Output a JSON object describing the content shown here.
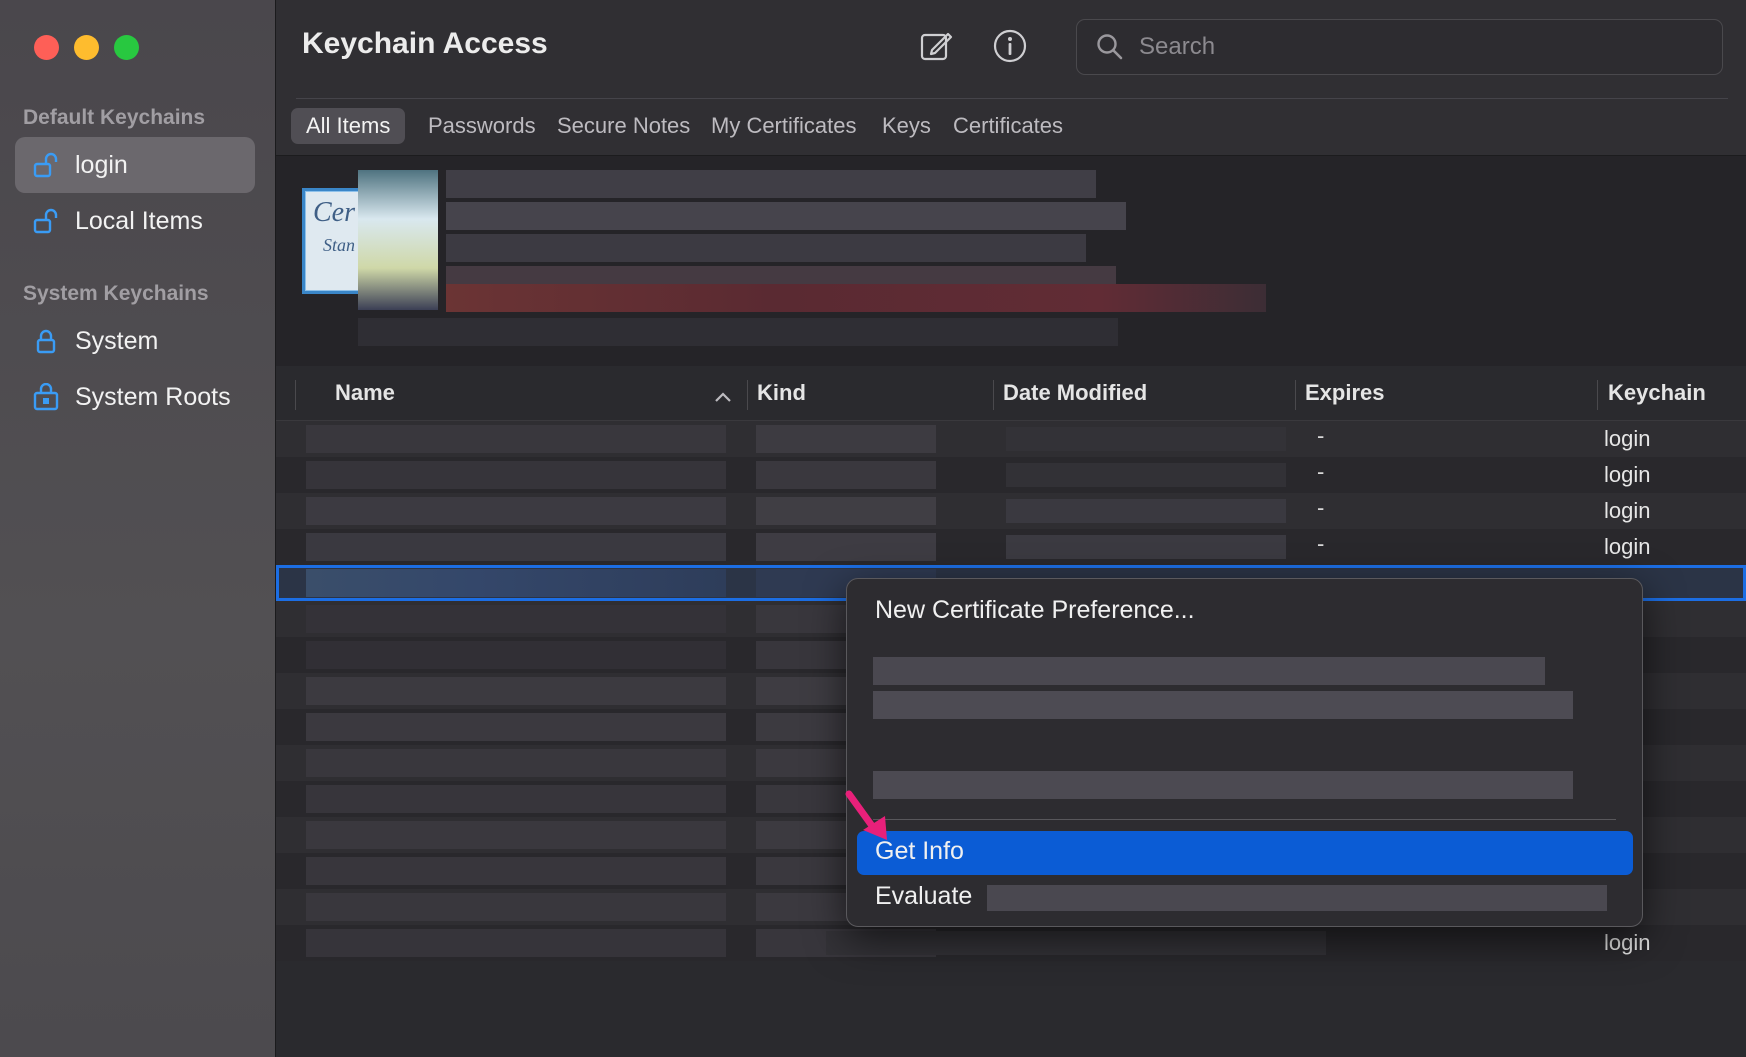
{
  "window": {
    "title": "Keychain Access",
    "controls": [
      "close",
      "minimize",
      "zoom"
    ]
  },
  "sidebar": {
    "default_heading": "Default Keychains",
    "system_heading": "System Keychains",
    "items": [
      {
        "label": "login",
        "icon": "unlocked-padlock-icon",
        "selected": true
      },
      {
        "label": "Local Items",
        "icon": "unlocked-padlock-icon",
        "selected": false
      },
      {
        "label": "System",
        "icon": "locked-padlock-icon",
        "selected": false
      },
      {
        "label": "System Roots",
        "icon": "locked-cabinet-icon",
        "selected": false
      }
    ]
  },
  "toolbar": {
    "new_item_icon": "compose-icon",
    "info_icon": "info-icon",
    "search_placeholder": "Search",
    "search_value": ""
  },
  "tabs": [
    "All Items",
    "Passwords",
    "Secure Notes",
    "My Certificates",
    "Keys",
    "Certificates"
  ],
  "active_tab": "All Items",
  "preview": {
    "icon_text_1": "Cer",
    "icon_text_2": "Stan"
  },
  "table": {
    "columns": [
      "Name",
      "Kind",
      "Date Modified",
      "Expires",
      "Keychain"
    ],
    "sort_column": "Name",
    "sort_direction": "ascending",
    "rows": [
      {
        "expires": "-",
        "keychain": "login"
      },
      {
        "expires": "-",
        "keychain": "login"
      },
      {
        "expires": "-",
        "keychain": "login"
      },
      {
        "expires": "-",
        "keychain": "login"
      },
      {
        "expires": "",
        "keychain": "n",
        "selected": true
      },
      {
        "expires": "",
        "keychain": "n"
      },
      {
        "expires": "",
        "keychain": "n"
      },
      {
        "expires": "",
        "keychain": "n"
      },
      {
        "expires": "",
        "keychain": "n"
      },
      {
        "expires": "",
        "keychain": "n"
      },
      {
        "expires": "",
        "keychain": "n"
      },
      {
        "expires": "",
        "keychain": "n"
      },
      {
        "expires": "",
        "keychain": "n"
      },
      {
        "expires": "",
        "keychain": "n"
      },
      {
        "expires": "",
        "keychain": "login"
      }
    ]
  },
  "context_menu": {
    "items": [
      {
        "label": "New Certificate Preference..."
      },
      {
        "label": "Get Info",
        "highlighted": true
      },
      {
        "label": "Evaluate"
      }
    ]
  },
  "colors": {
    "accent": "#0b5cd5",
    "selection_outline": "#1c6ee4",
    "annotation_arrow": "#e8207a"
  }
}
